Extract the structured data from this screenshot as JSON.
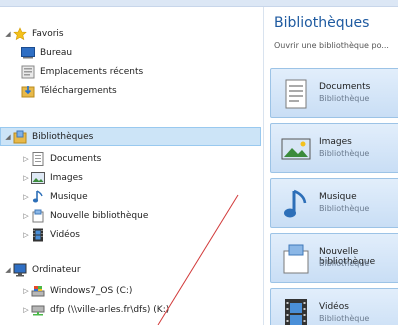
{
  "nav": {
    "favorites": {
      "label": "Favoris",
      "items": [
        "Bureau",
        "Emplacements récents",
        "Téléchargements"
      ]
    },
    "libraries": {
      "label": "Bibliothèques",
      "items": [
        "Documents",
        "Images",
        "Musique",
        "Nouvelle bibliothèque",
        "Vidéos"
      ]
    },
    "computer": {
      "label": "Ordinateur",
      "items": [
        "Windows7_OS (C:)",
        "dfp (\\\\ville-arles.fr\\dfs) (K:)"
      ]
    }
  },
  "content": {
    "title": "Bibliothèques",
    "subtitle": "Ouvrir une bibliothèque po...",
    "tiles": [
      {
        "name": "Documents",
        "kind": "Bibliothèque"
      },
      {
        "name": "Images",
        "kind": "Bibliothèque"
      },
      {
        "name": "Musique",
        "kind": "Bibliothèque"
      },
      {
        "name": "Nouvelle bibliothèque",
        "kind": "Bibliothèque"
      },
      {
        "name": "Vidéos",
        "kind": "Bibliothèque"
      }
    ]
  },
  "colors": {
    "selection": "#cce4f7",
    "accent_title": "#1e5aa0",
    "annotation_line": "#d23a3a"
  }
}
